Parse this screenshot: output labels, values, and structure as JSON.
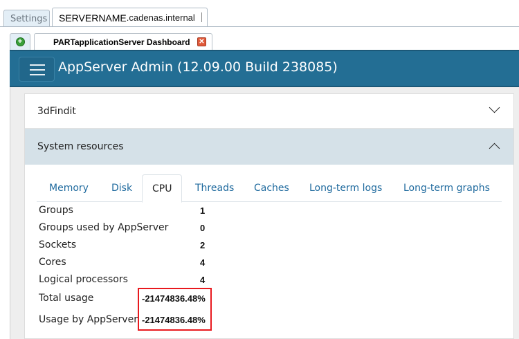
{
  "outer_tabs": {
    "settings": "Settings",
    "server_host": "SERVERNAME",
    "server_domain": ".cadenas.internal"
  },
  "inner_tab": {
    "label": "PARTapplicationServer Dashboard"
  },
  "header": {
    "title": "AppServer Admin (12.09.00 Build 238085)"
  },
  "accordion": {
    "item1": "3dFindit",
    "item2": "System resources"
  },
  "tabs": [
    "Memory",
    "Disk",
    "CPU",
    "Threads",
    "Caches",
    "Long-term logs",
    "Long-term graphs"
  ],
  "active_tab": "CPU",
  "cpu": [
    {
      "label": "Groups",
      "value": "1"
    },
    {
      "label": "Groups used by AppServer",
      "value": "0"
    },
    {
      "label": "Sockets",
      "value": "2"
    },
    {
      "label": "Cores",
      "value": "4"
    },
    {
      "label": "Logical processors",
      "value": "4"
    },
    {
      "label": "Total usage",
      "value": "-21474836.48%"
    },
    {
      "label": "Usage by AppServer",
      "value": "-21474836.48%"
    }
  ],
  "colors": {
    "header": "#236e94",
    "highlight": "#e8191e",
    "tab_link": "#1f6a9e"
  }
}
